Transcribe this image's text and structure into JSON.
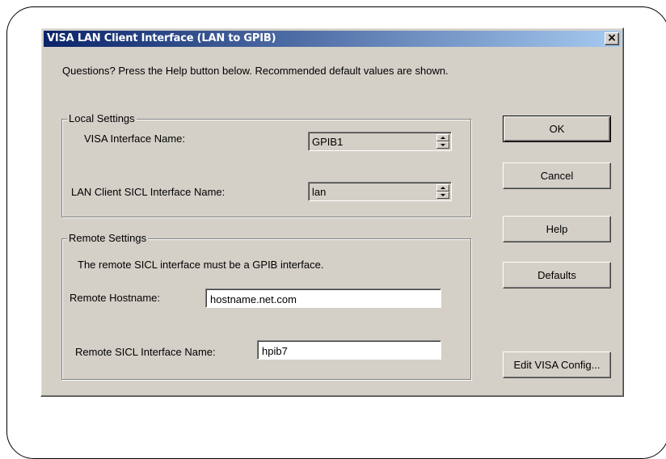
{
  "window": {
    "title": "VISA LAN Client Interface (LAN to GPIB)",
    "close_glyph": "×"
  },
  "instructions": "Questions?  Press the Help button below.  Recommended default values are shown.",
  "local_settings": {
    "label": "Local Settings",
    "visa_interface_name_label": "VISA Interface Name:",
    "visa_interface_name_value": "GPIB1",
    "lan_client_sicl_label": "LAN Client SICL Interface Name:",
    "lan_client_sicl_value": "lan"
  },
  "remote_settings": {
    "label": "Remote Settings",
    "note": "The remote SICL interface must be a GPIB interface.",
    "hostname_label": "Remote Hostname:",
    "hostname_value": "hostname.net.com",
    "sicl_name_label": "Remote SICL Interface Name:",
    "sicl_name_value": "hpib7"
  },
  "buttons": {
    "ok": "OK",
    "cancel": "Cancel",
    "help": "Help",
    "defaults": "Defaults",
    "edit_visa_config": "Edit VISA Config..."
  },
  "icons": {
    "close": "close-icon",
    "spin_up": "spin-up-arrow-icon",
    "spin_down": "spin-down-arrow-icon"
  },
  "colors": {
    "title_bar_start": "#0a246a",
    "title_bar_end": "#a6caf0",
    "dialog_face": "#d4d0c8"
  }
}
